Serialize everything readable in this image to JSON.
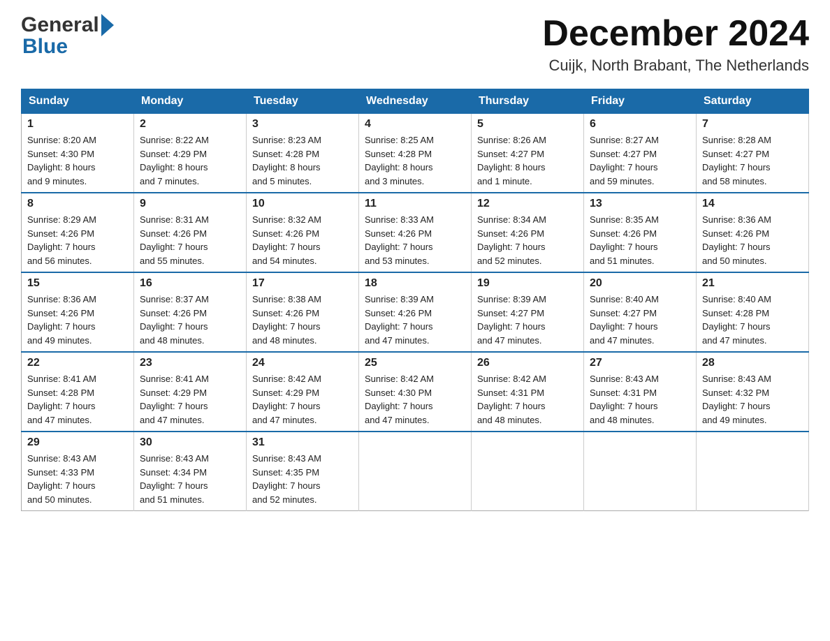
{
  "header": {
    "logo_general": "General",
    "logo_blue": "Blue",
    "month_title": "December 2024",
    "location": "Cuijk, North Brabant, The Netherlands"
  },
  "weekdays": [
    "Sunday",
    "Monday",
    "Tuesday",
    "Wednesday",
    "Thursday",
    "Friday",
    "Saturday"
  ],
  "weeks": [
    [
      {
        "day": "1",
        "sunrise": "8:20 AM",
        "sunset": "4:30 PM",
        "daylight": "8 hours and 9 minutes."
      },
      {
        "day": "2",
        "sunrise": "8:22 AM",
        "sunset": "4:29 PM",
        "daylight": "8 hours and 7 minutes."
      },
      {
        "day": "3",
        "sunrise": "8:23 AM",
        "sunset": "4:28 PM",
        "daylight": "8 hours and 5 minutes."
      },
      {
        "day": "4",
        "sunrise": "8:25 AM",
        "sunset": "4:28 PM",
        "daylight": "8 hours and 3 minutes."
      },
      {
        "day": "5",
        "sunrise": "8:26 AM",
        "sunset": "4:27 PM",
        "daylight": "8 hours and 1 minute."
      },
      {
        "day": "6",
        "sunrise": "8:27 AM",
        "sunset": "4:27 PM",
        "daylight": "7 hours and 59 minutes."
      },
      {
        "day": "7",
        "sunrise": "8:28 AM",
        "sunset": "4:27 PM",
        "daylight": "7 hours and 58 minutes."
      }
    ],
    [
      {
        "day": "8",
        "sunrise": "8:29 AM",
        "sunset": "4:26 PM",
        "daylight": "7 hours and 56 minutes."
      },
      {
        "day": "9",
        "sunrise": "8:31 AM",
        "sunset": "4:26 PM",
        "daylight": "7 hours and 55 minutes."
      },
      {
        "day": "10",
        "sunrise": "8:32 AM",
        "sunset": "4:26 PM",
        "daylight": "7 hours and 54 minutes."
      },
      {
        "day": "11",
        "sunrise": "8:33 AM",
        "sunset": "4:26 PM",
        "daylight": "7 hours and 53 minutes."
      },
      {
        "day": "12",
        "sunrise": "8:34 AM",
        "sunset": "4:26 PM",
        "daylight": "7 hours and 52 minutes."
      },
      {
        "day": "13",
        "sunrise": "8:35 AM",
        "sunset": "4:26 PM",
        "daylight": "7 hours and 51 minutes."
      },
      {
        "day": "14",
        "sunrise": "8:36 AM",
        "sunset": "4:26 PM",
        "daylight": "7 hours and 50 minutes."
      }
    ],
    [
      {
        "day": "15",
        "sunrise": "8:36 AM",
        "sunset": "4:26 PM",
        "daylight": "7 hours and 49 minutes."
      },
      {
        "day": "16",
        "sunrise": "8:37 AM",
        "sunset": "4:26 PM",
        "daylight": "7 hours and 48 minutes."
      },
      {
        "day": "17",
        "sunrise": "8:38 AM",
        "sunset": "4:26 PM",
        "daylight": "7 hours and 48 minutes."
      },
      {
        "day": "18",
        "sunrise": "8:39 AM",
        "sunset": "4:26 PM",
        "daylight": "7 hours and 47 minutes."
      },
      {
        "day": "19",
        "sunrise": "8:39 AM",
        "sunset": "4:27 PM",
        "daylight": "7 hours and 47 minutes."
      },
      {
        "day": "20",
        "sunrise": "8:40 AM",
        "sunset": "4:27 PM",
        "daylight": "7 hours and 47 minutes."
      },
      {
        "day": "21",
        "sunrise": "8:40 AM",
        "sunset": "4:28 PM",
        "daylight": "7 hours and 47 minutes."
      }
    ],
    [
      {
        "day": "22",
        "sunrise": "8:41 AM",
        "sunset": "4:28 PM",
        "daylight": "7 hours and 47 minutes."
      },
      {
        "day": "23",
        "sunrise": "8:41 AM",
        "sunset": "4:29 PM",
        "daylight": "7 hours and 47 minutes."
      },
      {
        "day": "24",
        "sunrise": "8:42 AM",
        "sunset": "4:29 PM",
        "daylight": "7 hours and 47 minutes."
      },
      {
        "day": "25",
        "sunrise": "8:42 AM",
        "sunset": "4:30 PM",
        "daylight": "7 hours and 47 minutes."
      },
      {
        "day": "26",
        "sunrise": "8:42 AM",
        "sunset": "4:31 PM",
        "daylight": "7 hours and 48 minutes."
      },
      {
        "day": "27",
        "sunrise": "8:43 AM",
        "sunset": "4:31 PM",
        "daylight": "7 hours and 48 minutes."
      },
      {
        "day": "28",
        "sunrise": "8:43 AM",
        "sunset": "4:32 PM",
        "daylight": "7 hours and 49 minutes."
      }
    ],
    [
      {
        "day": "29",
        "sunrise": "8:43 AM",
        "sunset": "4:33 PM",
        "daylight": "7 hours and 50 minutes."
      },
      {
        "day": "30",
        "sunrise": "8:43 AM",
        "sunset": "4:34 PM",
        "daylight": "7 hours and 51 minutes."
      },
      {
        "day": "31",
        "sunrise": "8:43 AM",
        "sunset": "4:35 PM",
        "daylight": "7 hours and 52 minutes."
      },
      null,
      null,
      null,
      null
    ]
  ],
  "labels": {
    "sunrise": "Sunrise: ",
    "sunset": "Sunset: ",
    "daylight": "Daylight: "
  }
}
